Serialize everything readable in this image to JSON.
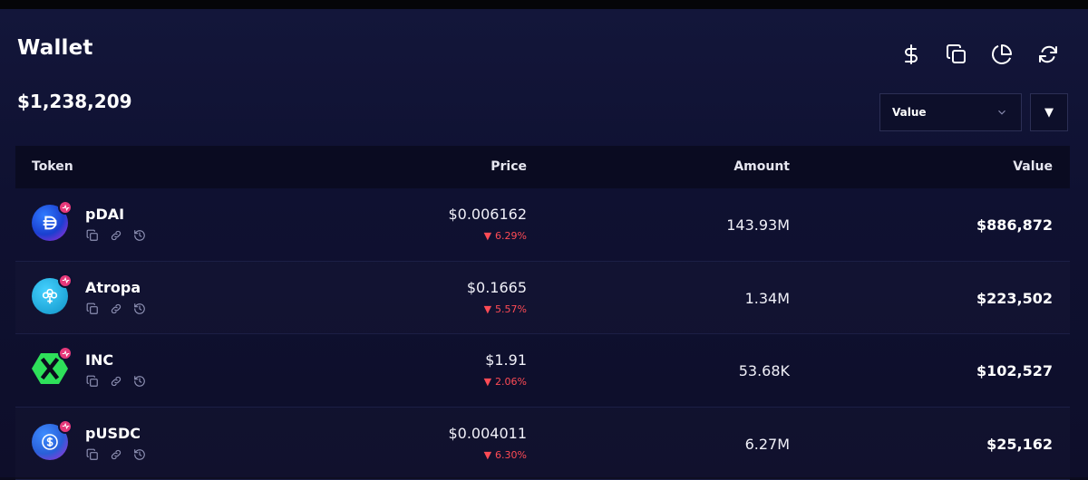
{
  "header": {
    "title": "Wallet",
    "total_value": "$1,238,209"
  },
  "toolbar": {
    "icons": [
      "dollar-icon",
      "copy-icon",
      "pie-chart-icon",
      "refresh-icon"
    ]
  },
  "sort": {
    "selected": "Value",
    "direction_symbol": "▼"
  },
  "table": {
    "columns": {
      "token": "Token",
      "price": "Price",
      "amount": "Amount",
      "value": "Value"
    },
    "rows": [
      {
        "name": "pDAI",
        "price": "$0.006162",
        "change": "6.29%",
        "amount": "143.93M",
        "value": "$886,872",
        "icon_color": "#1b5bd6"
      },
      {
        "name": "Atropa",
        "price": "$0.1665",
        "change": "5.57%",
        "amount": "1.34M",
        "value": "$223,502",
        "icon_color": "#1fa6d8"
      },
      {
        "name": "INC",
        "price": "$1.91",
        "change": "2.06%",
        "amount": "53.68K",
        "value": "$102,527",
        "icon_color": "#2ee05a"
      },
      {
        "name": "pUSDC",
        "price": "$0.004011",
        "change": "6.30%",
        "amount": "6.27M",
        "value": "$25,162",
        "icon_color": "#2a6fd8"
      }
    ]
  },
  "colors": {
    "background": "#0f1131",
    "negative": "#ff4b55",
    "badge": "#e6397a"
  }
}
